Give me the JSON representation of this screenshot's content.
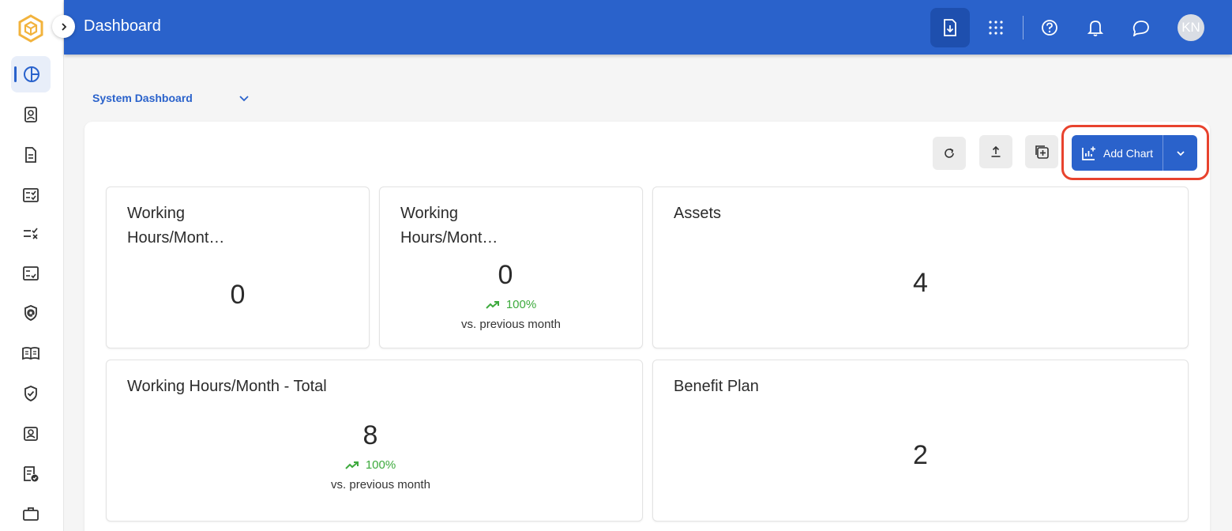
{
  "header": {
    "title": "Dashboard",
    "avatar_initials": "KN"
  },
  "dashboard_selector": {
    "value": "System Dashboard"
  },
  "toolbar": {
    "add_chart_label": "Add Chart"
  },
  "cards": [
    {
      "title_line1": "Working",
      "title_line2": "Hours/Mont…",
      "value": "0"
    },
    {
      "title_line1": "Working",
      "title_line2": "Hours/Mont…",
      "value": "0",
      "trend": "100%",
      "compare": "vs. previous month"
    },
    {
      "title": "Assets",
      "value": "4"
    },
    {
      "title": "Working Hours/Month - Total",
      "value": "8",
      "trend": "100%",
      "compare": "vs. previous month"
    },
    {
      "title": "Benefit Plan",
      "value": "2"
    }
  ],
  "colors": {
    "brand_blue": "#2a62cb",
    "trend_green": "#3daa3d",
    "highlight_red": "#e8432e",
    "logo_gold": "#f2b33d"
  },
  "icons": {
    "sidebar": [
      "dashboard-pie-icon",
      "contact-card-icon",
      "document-icon",
      "checklist-icon",
      "task-x-icon",
      "review-list-icon",
      "shield-at-icon",
      "book-icon",
      "shield-check-icon",
      "badge-user-icon",
      "document-check-icon",
      "briefcase-icon"
    ],
    "topbar": [
      "download-file-icon",
      "apps-grid-icon",
      "help-icon",
      "bell-icon",
      "chat-icon"
    ],
    "panel_tools": [
      "refresh-icon",
      "upload-icon",
      "duplicate-add-icon",
      "add-chart-icon",
      "chevron-down-icon"
    ]
  }
}
